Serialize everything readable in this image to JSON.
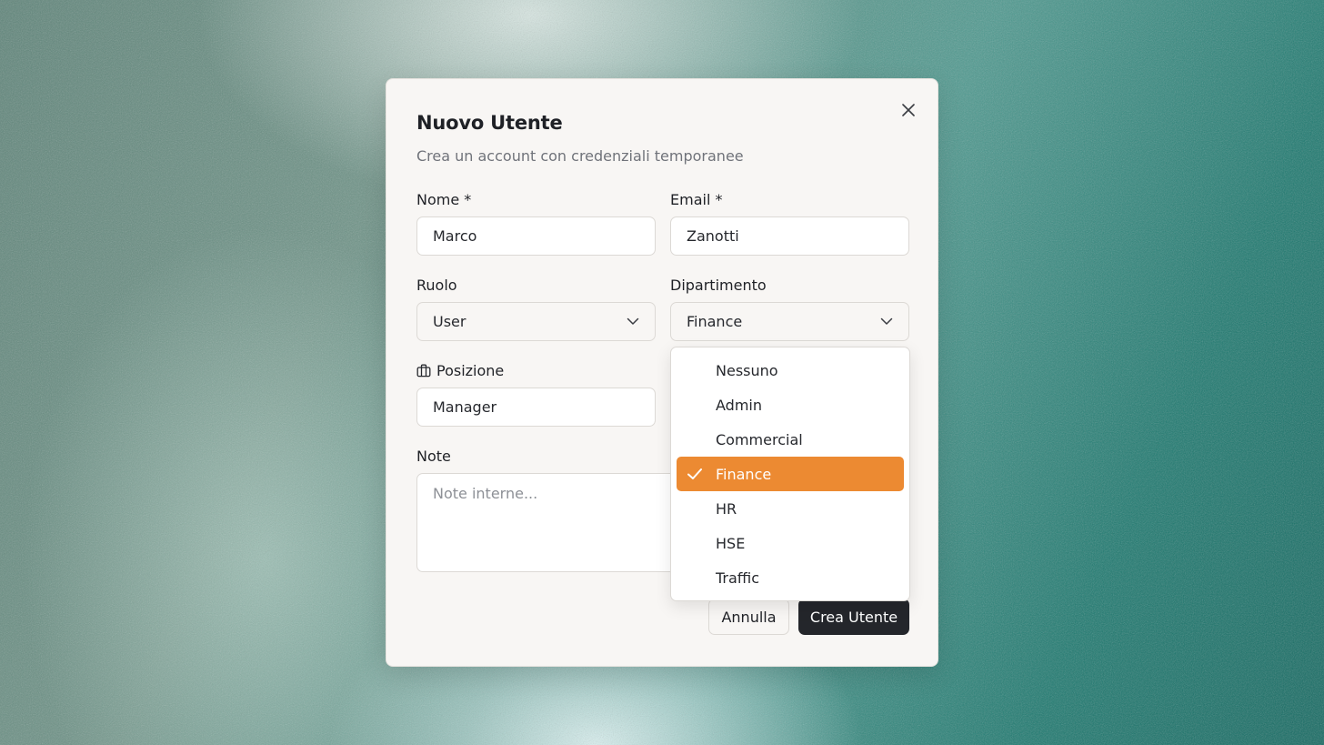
{
  "modal": {
    "title": "Nuovo Utente",
    "subtitle": "Crea un account con credenziali temporanee"
  },
  "form": {
    "nome": {
      "label": "Nome *",
      "value": "Marco"
    },
    "email": {
      "label": "Email *",
      "value": "Zanotti"
    },
    "ruolo": {
      "label": "Ruolo",
      "value": "User"
    },
    "dipartimento": {
      "label": "Dipartimento",
      "value": "Finance"
    },
    "posizione": {
      "label": "Posizione",
      "value": "Manager",
      "icon": "briefcase-icon"
    },
    "note": {
      "label": "Note",
      "placeholder": "Note interne..."
    }
  },
  "dropdown": {
    "options": [
      {
        "label": "Nessuno",
        "selected": false
      },
      {
        "label": "Admin",
        "selected": false
      },
      {
        "label": "Commercial",
        "selected": false
      },
      {
        "label": "Finance",
        "selected": true
      },
      {
        "label": "HR",
        "selected": false
      },
      {
        "label": "HSE",
        "selected": false
      },
      {
        "label": "Traffic",
        "selected": false
      }
    ]
  },
  "actions": {
    "cancel_label": "Annulla",
    "submit_label": "Crea Utente"
  },
  "colors": {
    "accent_selected": "#ec8a32",
    "primary_button": "#24262b",
    "modal_bg": "#f8f6f4"
  }
}
